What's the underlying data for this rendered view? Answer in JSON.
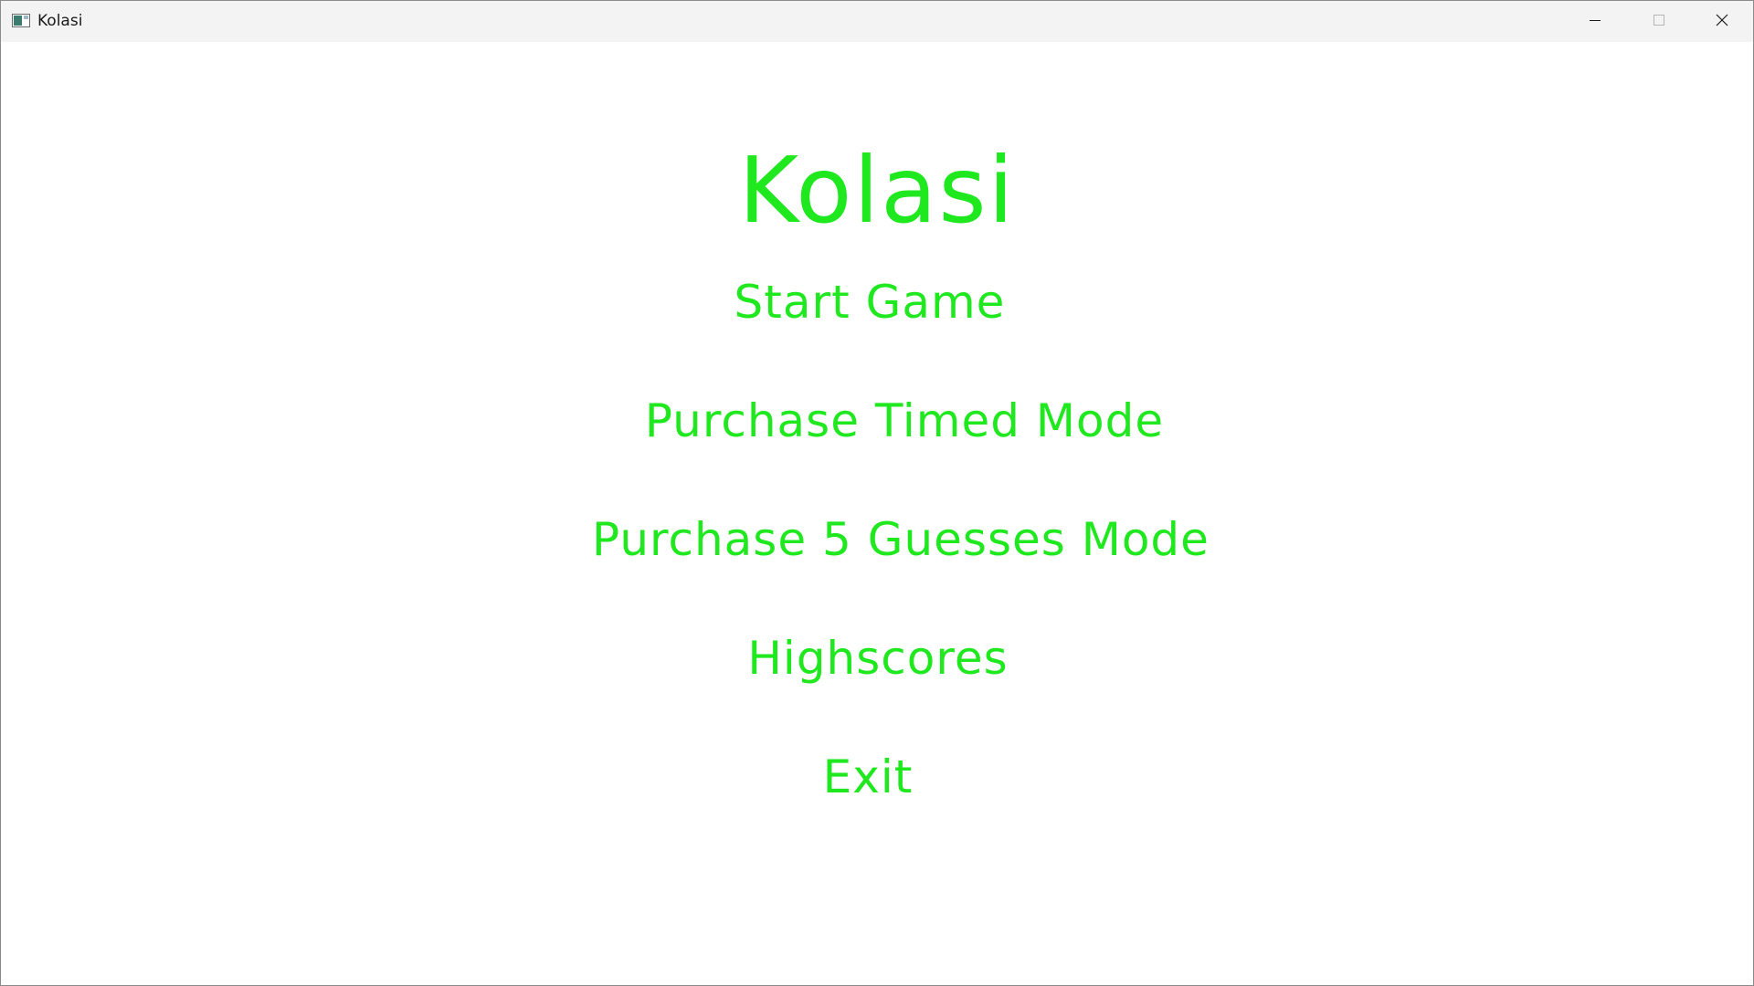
{
  "window": {
    "title": "Kolasi",
    "controls": {
      "minimize_icon": "minimize-icon",
      "maximize_icon": "maximize-icon",
      "close_icon": "close-icon"
    }
  },
  "game": {
    "title": "Kolasi",
    "menu": [
      {
        "id": "start",
        "label": "Start Game"
      },
      {
        "id": "timed",
        "label": "Purchase Timed Mode"
      },
      {
        "id": "guesses",
        "label": "Purchase 5 Guesses Mode"
      },
      {
        "id": "highscores",
        "label": "Highscores"
      },
      {
        "id": "exit",
        "label": "Exit"
      }
    ]
  },
  "colors": {
    "accent": "#1fe81f",
    "background": "#ffffff",
    "titlebar": "#f3f3f3"
  }
}
